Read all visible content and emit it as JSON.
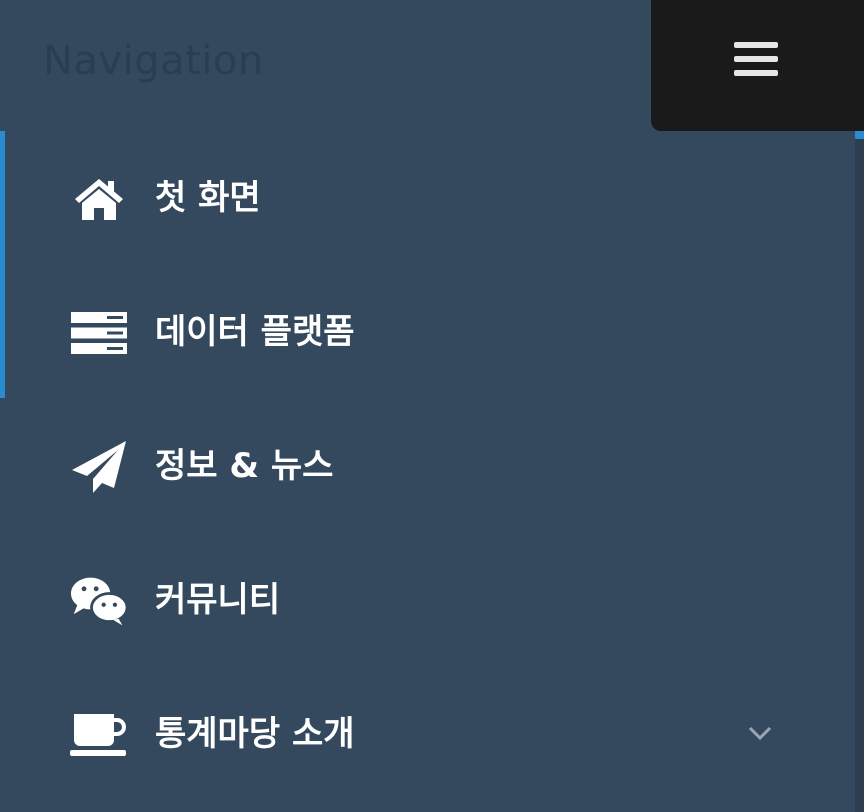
{
  "header": {
    "title": "Navigation",
    "menu_toggle_icon": "hamburger-icon"
  },
  "colors": {
    "sidebar_bg": "#34495e",
    "toggle_bg": "#1a1a1a",
    "accent": "#2a8cd0",
    "text": "#ffffff",
    "title_text": "#2b3d50"
  },
  "menu": {
    "items": [
      {
        "label": "첫 화면",
        "icon": "home-icon",
        "active": true
      },
      {
        "label": "데이터 플랫폼",
        "icon": "server-icon",
        "active": true
      },
      {
        "label": "정보 & 뉴스",
        "icon": "paper-plane-icon",
        "active": false
      },
      {
        "label": "커뮤니티",
        "icon": "chat-bubbles-icon",
        "active": false
      },
      {
        "label": "통계마당 소개",
        "icon": "coffee-cup-icon",
        "active": false,
        "has_submenu": true,
        "submenu_icon": "chevron-down-icon"
      }
    ]
  }
}
